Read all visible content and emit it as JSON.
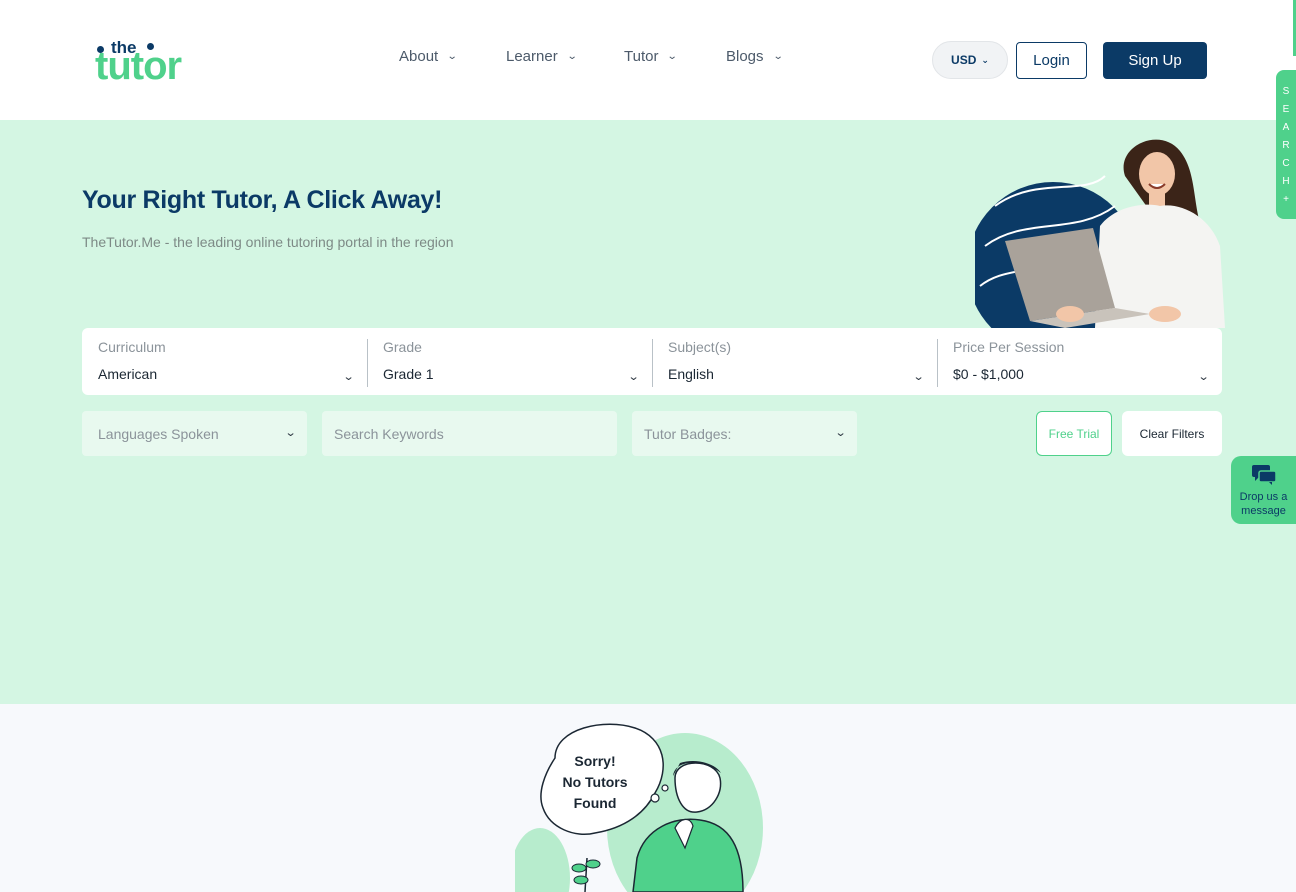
{
  "header": {
    "logo_top": "the",
    "logo_main": "tutor",
    "nav": [
      {
        "label": "About"
      },
      {
        "label": "Learner"
      },
      {
        "label": "Tutor"
      },
      {
        "label": "Blogs"
      }
    ],
    "currency": "USD",
    "login_label": "Login",
    "signup_label": "Sign Up"
  },
  "hero": {
    "title": "Your Right Tutor, A Click Away!",
    "subtitle": "TheTutor.Me - the leading online tutoring portal in the region"
  },
  "filters": {
    "curriculum": {
      "label": "Curriculum",
      "value": "American"
    },
    "grade": {
      "label": "Grade",
      "value": "Grade 1"
    },
    "subjects": {
      "label": "Subject(s)",
      "value": "English"
    },
    "price": {
      "label": "Price Per Session",
      "value": "$0 - $1,000"
    },
    "languages_placeholder": "Languages Spoken",
    "keywords_placeholder": "Search Keywords",
    "badges_placeholder": "Tutor Badges:",
    "free_trial_label": "Free Trial",
    "clear_label": "Clear Filters"
  },
  "side_tab": {
    "letters": [
      "S",
      "E",
      "A",
      "R",
      "C",
      "H",
      "+"
    ]
  },
  "message_widget": {
    "line1": "Drop us a",
    "line2": "message"
  },
  "empty_state": {
    "line1": "Sorry!",
    "line2": "No Tutors",
    "line3": "Found"
  },
  "colors": {
    "brand_navy": "#0b3a66",
    "brand_green": "#4fd18b",
    "hero_bg": "#d4f6e3"
  }
}
